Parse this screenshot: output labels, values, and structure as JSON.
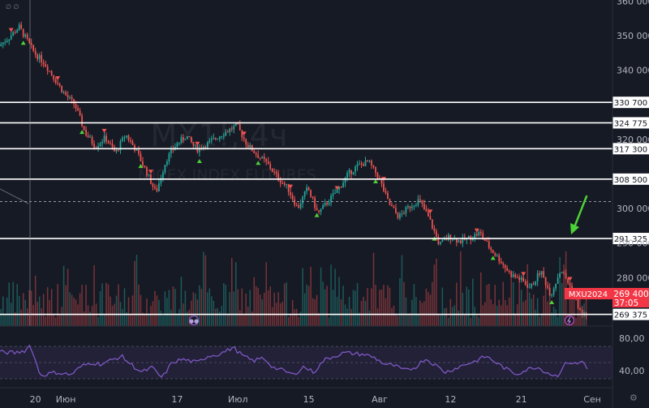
{
  "watermark": {
    "symbol": "MX1!, 4ч",
    "name": "MICEX INDEX FUTURES"
  },
  "colors": {
    "background": "#161a25",
    "up": "#26a69a",
    "down": "#ef5350",
    "level": "#ffffff",
    "rsi": "#7e57c2",
    "price_label": "#f23645",
    "arrow": "#4cd137"
  },
  "chart_data": [
    {
      "type": "candlestick",
      "y_ticks": [
        {
          "v": 360000,
          "t": "360 000"
        },
        {
          "v": 350000,
          "t": "350 000"
        },
        {
          "v": 340000,
          "t": "340 000"
        },
        {
          "v": 320000,
          "t": "320 000"
        },
        {
          "v": 300000,
          "t": "300 000"
        },
        {
          "v": 290000,
          "t": "290 000"
        },
        {
          "v": 280000,
          "t": "280 000"
        }
      ],
      "ylim": [
        266000,
        360300
      ],
      "x_ticks": [
        {
          "x": 20,
          "t": "20"
        },
        {
          "x": 26,
          "t": "Июн"
        },
        {
          "x": 48,
          "t": "17"
        },
        {
          "x": 60,
          "t": "Июл"
        },
        {
          "x": 74,
          "t": "15"
        },
        {
          "x": 88,
          "t": "Авг"
        },
        {
          "x": 102,
          "t": "12"
        },
        {
          "x": 116,
          "t": "21"
        },
        {
          "x": 130,
          "t": "Сен"
        }
      ],
      "xlim": [
        13,
        134
      ],
      "levels": [
        {
          "value": 330700,
          "label": "330 700"
        },
        {
          "value": 324775,
          "label": "324 775"
        },
        {
          "value": 317300,
          "label": "317 300"
        },
        {
          "value": 308500,
          "label": "308 500"
        },
        {
          "value": 291325,
          "label": "291 325"
        },
        {
          "value": 269375,
          "label": "269 375"
        }
      ],
      "dashed_level": 302000,
      "last_price": {
        "symbol": "MXU2024",
        "value": 269400,
        "label": "269 400",
        "timer": "37:05"
      },
      "anchors": [
        {
          "x": 13,
          "y": 347000
        },
        {
          "x": 15,
          "y": 349500
        },
        {
          "x": 17,
          "y": 352500
        },
        {
          "x": 20,
          "y": 345000
        },
        {
          "x": 22,
          "y": 342000
        },
        {
          "x": 24,
          "y": 337500
        },
        {
          "x": 26,
          "y": 333000
        },
        {
          "x": 28,
          "y": 330000
        },
        {
          "x": 30,
          "y": 322000
        },
        {
          "x": 32,
          "y": 318000
        },
        {
          "x": 34,
          "y": 320500
        },
        {
          "x": 36,
          "y": 316000
        },
        {
          "x": 38,
          "y": 321500
        },
        {
          "x": 40,
          "y": 317000
        },
        {
          "x": 42,
          "y": 311000
        },
        {
          "x": 44,
          "y": 304500
        },
        {
          "x": 46,
          "y": 314000
        },
        {
          "x": 48,
          "y": 318500
        },
        {
          "x": 50,
          "y": 321000
        },
        {
          "x": 52,
          "y": 317000
        },
        {
          "x": 54,
          "y": 318500
        },
        {
          "x": 57,
          "y": 321500
        },
        {
          "x": 60,
          "y": 324000
        },
        {
          "x": 62,
          "y": 318500
        },
        {
          "x": 64,
          "y": 315500
        },
        {
          "x": 66,
          "y": 313000
        },
        {
          "x": 68,
          "y": 309000
        },
        {
          "x": 70,
          "y": 306000
        },
        {
          "x": 72,
          "y": 300000
        },
        {
          "x": 74,
          "y": 306000
        },
        {
          "x": 76,
          "y": 298500
        },
        {
          "x": 78,
          "y": 302000
        },
        {
          "x": 80,
          "y": 305500
        },
        {
          "x": 82,
          "y": 310000
        },
        {
          "x": 84,
          "y": 312500
        },
        {
          "x": 86,
          "y": 313500
        },
        {
          "x": 88,
          "y": 309000
        },
        {
          "x": 90,
          "y": 301500
        },
        {
          "x": 92,
          "y": 297500
        },
        {
          "x": 94,
          "y": 300500
        },
        {
          "x": 96,
          "y": 302500
        },
        {
          "x": 98,
          "y": 297000
        },
        {
          "x": 100,
          "y": 289500
        },
        {
          "x": 102,
          "y": 292000
        },
        {
          "x": 104,
          "y": 290500
        },
        {
          "x": 106,
          "y": 291500
        },
        {
          "x": 108,
          "y": 293000
        },
        {
          "x": 110,
          "y": 288500
        },
        {
          "x": 112,
          "y": 285000
        },
        {
          "x": 114,
          "y": 281000
        },
        {
          "x": 116,
          "y": 279500
        },
        {
          "x": 118,
          "y": 277000
        },
        {
          "x": 120,
          "y": 282000
        },
        {
          "x": 122,
          "y": 275000
        },
        {
          "x": 124,
          "y": 282500
        },
        {
          "x": 126,
          "y": 277000
        },
        {
          "x": 128,
          "y": 269500
        },
        {
          "x": 129,
          "y": 269400
        }
      ]
    },
    {
      "type": "line",
      "indicator": "RSI",
      "y_ticks": [
        {
          "v": 80,
          "t": "80,00"
        },
        {
          "v": 40,
          "t": "40,00"
        }
      ],
      "ylim": [
        25,
        87
      ],
      "band": [
        30,
        70
      ],
      "anchors": [
        {
          "x": 13,
          "y": 63
        },
        {
          "x": 16,
          "y": 62
        },
        {
          "x": 18,
          "y": 65
        },
        {
          "x": 19,
          "y": 72
        },
        {
          "x": 20,
          "y": 52
        },
        {
          "x": 21,
          "y": 34
        },
        {
          "x": 24,
          "y": 38
        },
        {
          "x": 27,
          "y": 35
        },
        {
          "x": 29,
          "y": 45
        },
        {
          "x": 31,
          "y": 50
        },
        {
          "x": 33,
          "y": 48
        },
        {
          "x": 35,
          "y": 53
        },
        {
          "x": 37,
          "y": 58
        },
        {
          "x": 39,
          "y": 47
        },
        {
          "x": 41,
          "y": 38
        },
        {
          "x": 43,
          "y": 44
        },
        {
          "x": 45,
          "y": 31
        },
        {
          "x": 47,
          "y": 50
        },
        {
          "x": 49,
          "y": 54
        },
        {
          "x": 52,
          "y": 50
        },
        {
          "x": 54,
          "y": 58
        },
        {
          "x": 56,
          "y": 60
        },
        {
          "x": 58,
          "y": 65
        },
        {
          "x": 59,
          "y": 69
        },
        {
          "x": 61,
          "y": 58
        },
        {
          "x": 63,
          "y": 52
        },
        {
          "x": 65,
          "y": 56
        },
        {
          "x": 67,
          "y": 44
        },
        {
          "x": 69,
          "y": 40
        },
        {
          "x": 71,
          "y": 35
        },
        {
          "x": 73,
          "y": 45
        },
        {
          "x": 75,
          "y": 38
        },
        {
          "x": 77,
          "y": 53
        },
        {
          "x": 79,
          "y": 58
        },
        {
          "x": 81,
          "y": 62
        },
        {
          "x": 83,
          "y": 61
        },
        {
          "x": 85,
          "y": 60
        },
        {
          "x": 87,
          "y": 56
        },
        {
          "x": 89,
          "y": 48
        },
        {
          "x": 91,
          "y": 46
        },
        {
          "x": 93,
          "y": 40
        },
        {
          "x": 95,
          "y": 44
        },
        {
          "x": 97,
          "y": 55
        },
        {
          "x": 99,
          "y": 47
        },
        {
          "x": 101,
          "y": 38
        },
        {
          "x": 103,
          "y": 43
        },
        {
          "x": 105,
          "y": 48
        },
        {
          "x": 107,
          "y": 52
        },
        {
          "x": 109,
          "y": 58
        },
        {
          "x": 111,
          "y": 50
        },
        {
          "x": 113,
          "y": 42
        },
        {
          "x": 115,
          "y": 36
        },
        {
          "x": 117,
          "y": 41
        },
        {
          "x": 119,
          "y": 45
        },
        {
          "x": 121,
          "y": 38
        },
        {
          "x": 123,
          "y": 33
        },
        {
          "x": 125,
          "y": 51
        },
        {
          "x": 127,
          "y": 48
        },
        {
          "x": 128,
          "y": 52
        },
        {
          "x": 129,
          "y": 44
        }
      ]
    }
  ]
}
